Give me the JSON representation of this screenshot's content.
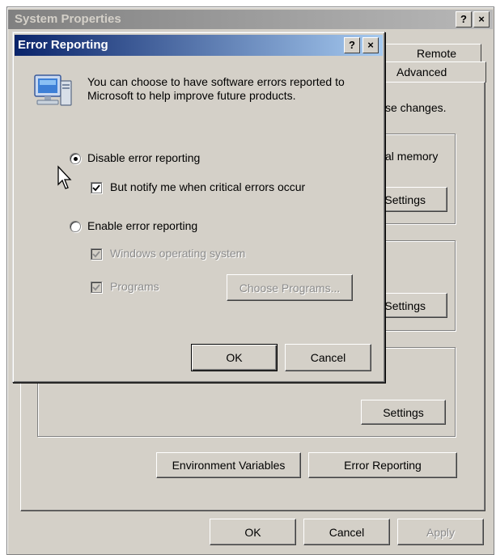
{
  "system_properties": {
    "title": "System Properties",
    "help_glyph": "?",
    "close_glyph": "×",
    "tabs": {
      "remote": "Remote",
      "advanced": "Advanced"
    },
    "partial_text": {
      "changes": "se changes.",
      "virtual_memory": "al memory"
    },
    "settings_partial_1": "Settings",
    "settings_partial_2": "Settings",
    "settings_button": "Settings",
    "environment_variables_button": "Environment Variables",
    "error_reporting_button": "Error Reporting",
    "ok_button": "OK",
    "cancel_button": "Cancel",
    "apply_button": "Apply"
  },
  "error_reporting": {
    "title": "Error Reporting",
    "help_glyph": "?",
    "close_glyph": "×",
    "description": "You can choose to have software errors reported to Microsoft to help improve future products.",
    "disable_label": "Disable error reporting",
    "disable_selected": true,
    "notify_label": "But notify me when critical errors occur",
    "notify_checked": true,
    "enable_label": "Enable error reporting",
    "enable_selected": false,
    "windows_os_label": "Windows operating system",
    "windows_os_checked": true,
    "programs_label": "Programs",
    "programs_checked": true,
    "choose_programs_button": "Choose Programs...",
    "ok_button": "OK",
    "cancel_button": "Cancel"
  },
  "colors": {
    "dialog_face": "#d4d0c8",
    "active_title_start": "#0a246a",
    "active_title_end": "#a6caf0",
    "inactive_title": "#808080"
  }
}
